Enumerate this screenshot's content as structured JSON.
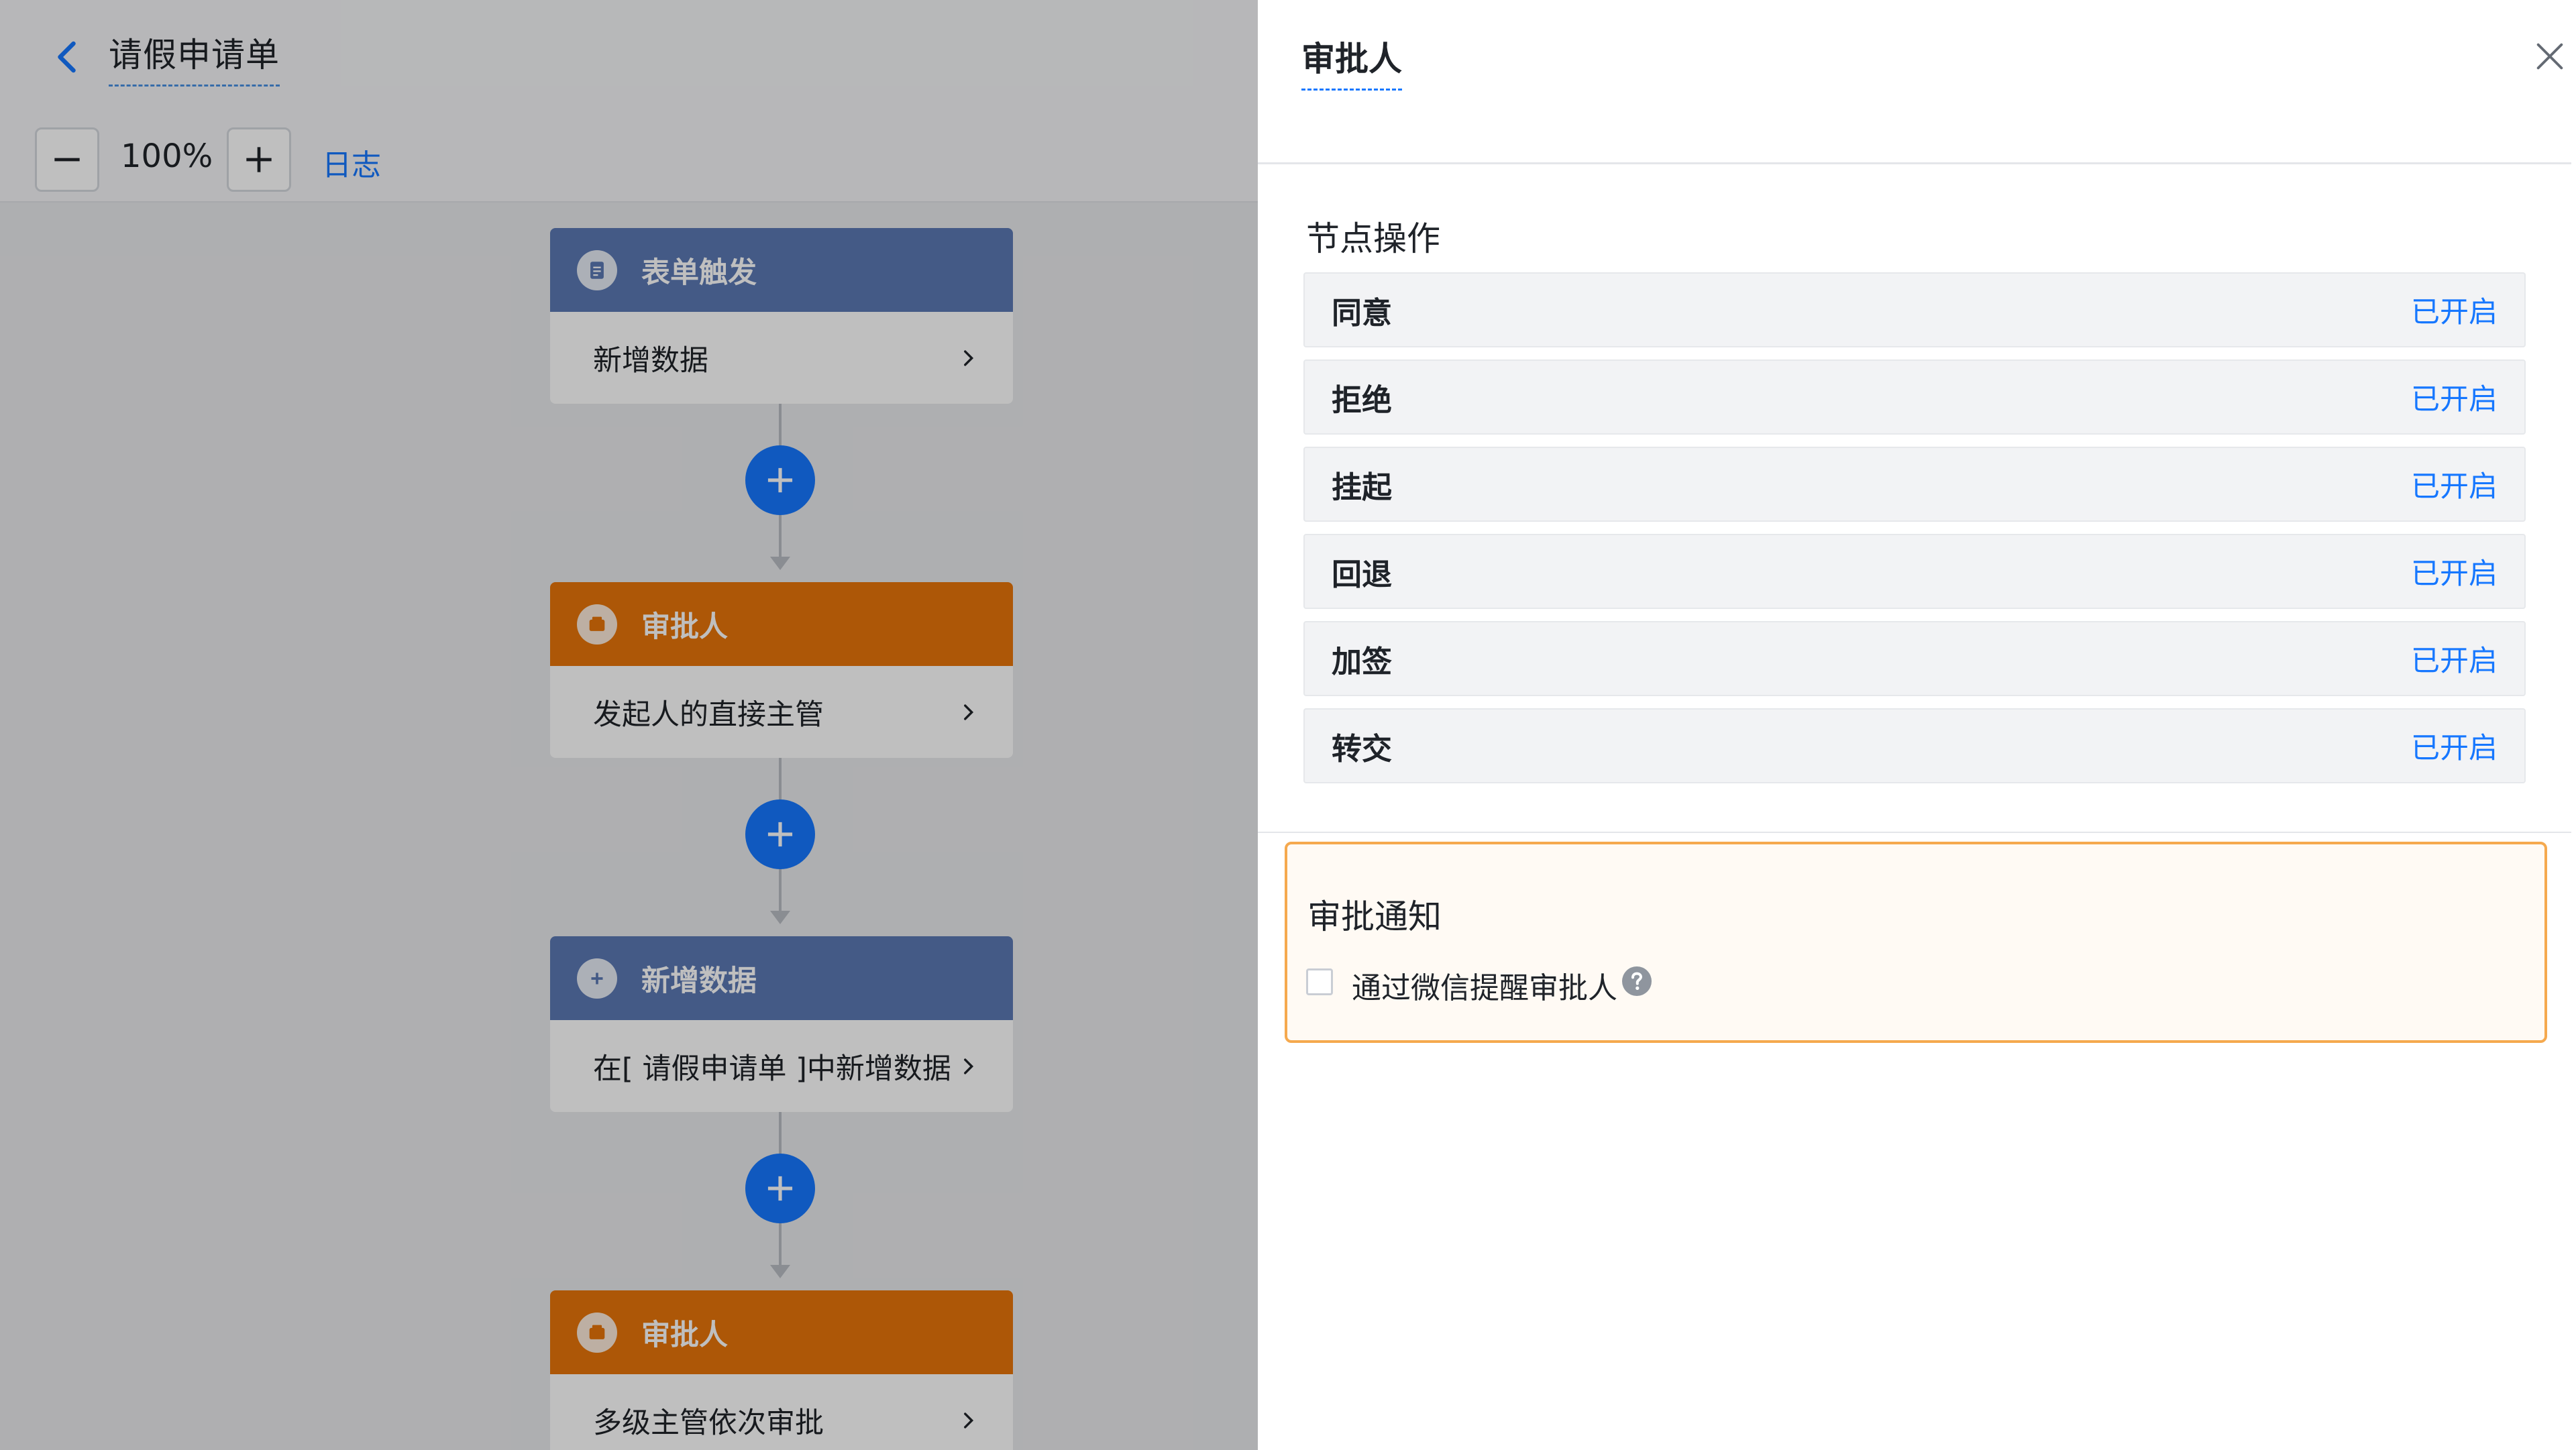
{
  "header": {
    "title": "请假申请单"
  },
  "toolbar": {
    "zoom_value": "100%",
    "log_label": "日志"
  },
  "workflow": {
    "nodes": [
      {
        "title": "表单触发",
        "detail": "新增数据",
        "color": "#5b78b3",
        "icon": "form-icon"
      },
      {
        "title": "审批人",
        "detail": "发起人的直接主管",
        "color": "#e7750a",
        "icon": "approver-icon"
      },
      {
        "title": "新增数据",
        "detail": "在[ 请假申请单 ]中新增数据",
        "color": "#5b78b3",
        "icon": "add-data-icon"
      },
      {
        "title": "审批人",
        "detail": "多级主管依次审批",
        "color": "#e7750a",
        "icon": "approver-icon"
      }
    ]
  },
  "drawer": {
    "title": "审批人",
    "section_title": "节点操作",
    "operations": [
      {
        "name": "同意",
        "status": "已开启"
      },
      {
        "name": "拒绝",
        "status": "已开启"
      },
      {
        "name": "挂起",
        "status": "已开启"
      },
      {
        "name": "回退",
        "status": "已开启"
      },
      {
        "name": "加签",
        "status": "已开启"
      },
      {
        "name": "转交",
        "status": "已开启"
      }
    ],
    "notify": {
      "title": "审批通知",
      "checkbox_label": "通过微信提醒审批人",
      "checked": false
    }
  },
  "colors": {
    "accent": "#1677ff",
    "approver": "#e7750a",
    "trigger": "#5b78b3",
    "highlight_border": "#f5a94e"
  }
}
